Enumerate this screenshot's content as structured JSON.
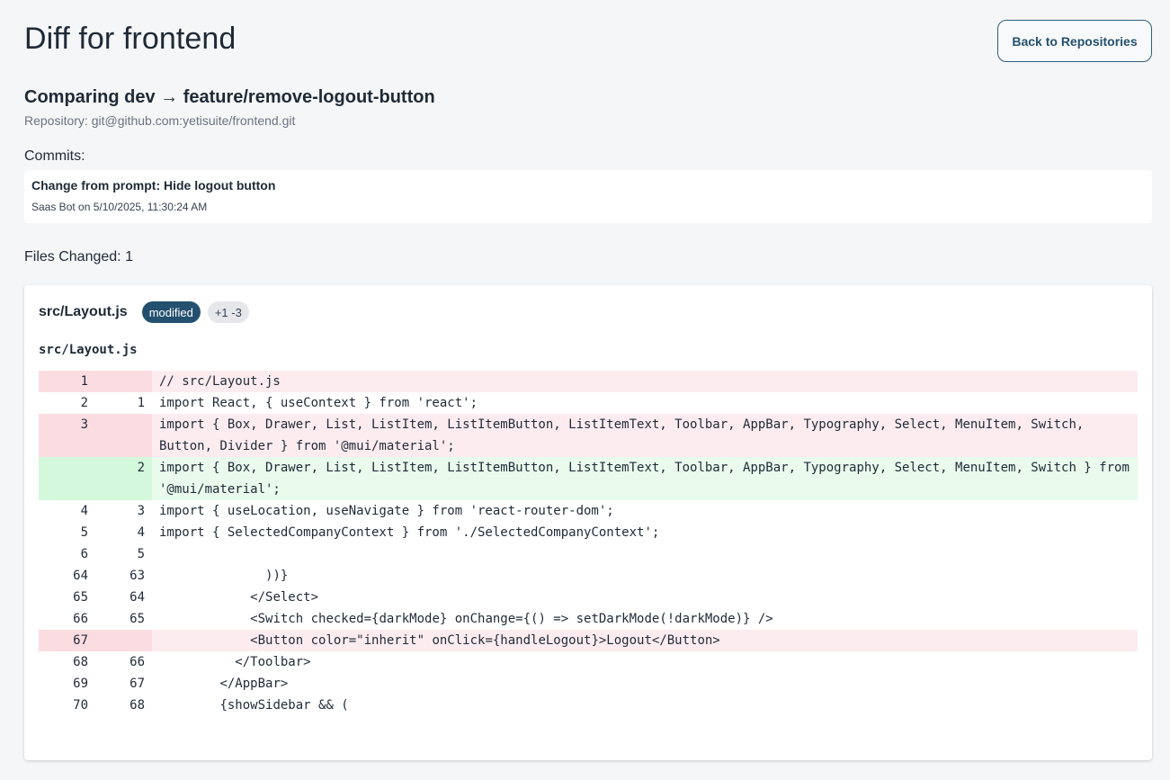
{
  "page": {
    "title": "Diff for frontend",
    "back_label": "Back to Repositories"
  },
  "comparison": {
    "title": "Comparing dev → feature/remove-logout-button",
    "repository": "Repository: git@github.com:yetisuite/frontend.git"
  },
  "commits": {
    "label": "Commits:",
    "items": [
      {
        "message": "Change from prompt: Hide logout button",
        "meta": "Saas Bot on 5/10/2025, 11:30:24 AM"
      }
    ]
  },
  "files_changed": "Files Changed: 1",
  "file": {
    "name": "src/Layout.js",
    "status": "modified",
    "stats": "+1 -3",
    "diff_title": "src/Layout.js",
    "lines": [
      {
        "type": "del",
        "old": "1",
        "new": "",
        "code": "// src/Layout.js"
      },
      {
        "type": "ctx",
        "old": "2",
        "new": "1",
        "code": "import React, { useContext } from 'react';"
      },
      {
        "type": "del",
        "old": "3",
        "new": "",
        "code": "import { Box, Drawer, List, ListItem, ListItemButton, ListItemText, Toolbar, AppBar, Typography, Select, MenuItem, Switch, Button, Divider } from '@mui/material';"
      },
      {
        "type": "add",
        "old": "",
        "new": "2",
        "code": "import { Box, Drawer, List, ListItem, ListItemButton, ListItemText, Toolbar, AppBar, Typography, Select, MenuItem, Switch } from '@mui/material';"
      },
      {
        "type": "ctx",
        "old": "4",
        "new": "3",
        "code": "import { useLocation, useNavigate } from 'react-router-dom';"
      },
      {
        "type": "ctx",
        "old": "5",
        "new": "4",
        "code": "import { SelectedCompanyContext } from './SelectedCompanyContext';"
      },
      {
        "type": "ctx",
        "old": "6",
        "new": "5",
        "code": ""
      },
      {
        "type": "ctx",
        "old": "64",
        "new": "63",
        "code": "              ))}"
      },
      {
        "type": "ctx",
        "old": "65",
        "new": "64",
        "code": "            </Select>"
      },
      {
        "type": "ctx",
        "old": "66",
        "new": "65",
        "code": "            <Switch checked={darkMode} onChange={() => setDarkMode(!darkMode)} />"
      },
      {
        "type": "del",
        "old": "67",
        "new": "",
        "code": "            <Button color=\"inherit\" onClick={handleLogout}>Logout</Button>"
      },
      {
        "type": "ctx",
        "old": "68",
        "new": "66",
        "code": "          </Toolbar>"
      },
      {
        "type": "ctx",
        "old": "69",
        "new": "67",
        "code": "        </AppBar>"
      },
      {
        "type": "ctx",
        "old": "70",
        "new": "68",
        "code": "        {showSidebar && ("
      }
    ]
  },
  "colors": {
    "accent": "#24506f",
    "deleted_line_bg": "#fdecef",
    "added_line_bg": "#e8fbec"
  }
}
